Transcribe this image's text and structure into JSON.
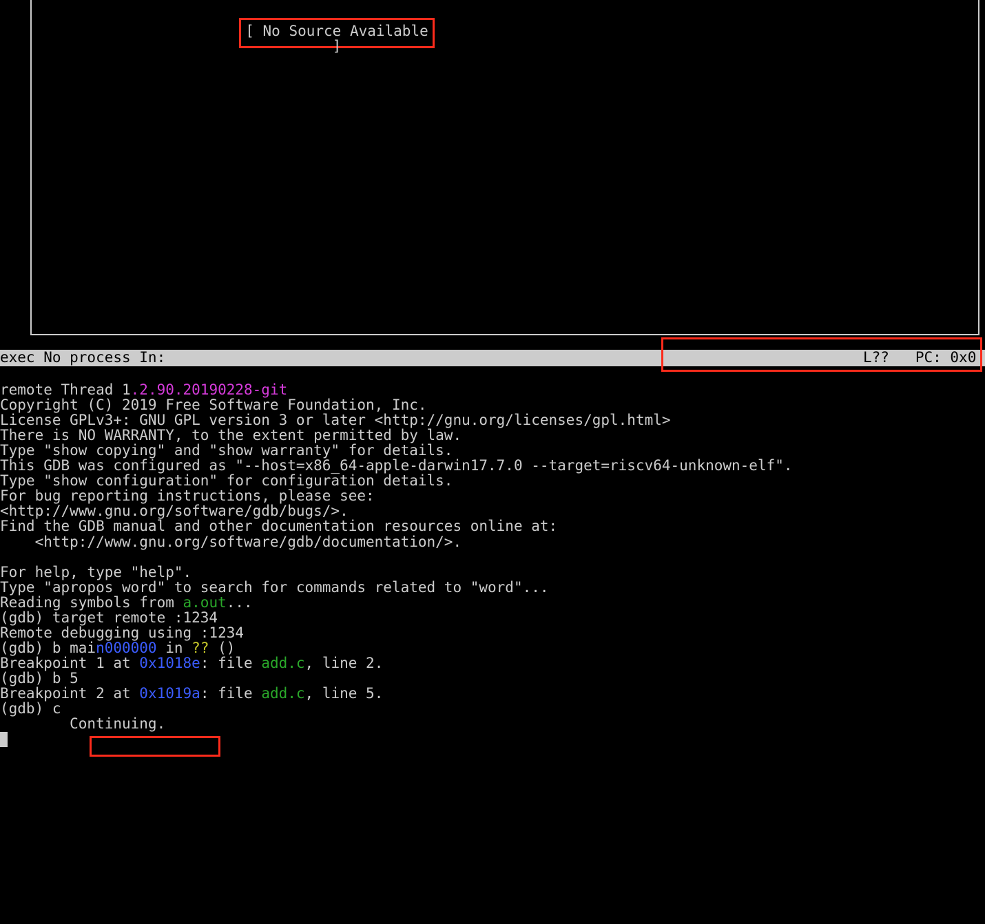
{
  "source_panel": {
    "no_source": "[ No Source Available ]"
  },
  "status_bar": {
    "left": "exec No process In:",
    "right": "L??   PC: 0x0 "
  },
  "thread_line": {
    "prefix": "remote Thread 1",
    "version": ".2.90.20190228-git"
  },
  "body_lines": [
    "Copyright (C) 2019 Free Software Foundation, Inc.",
    "License GPLv3+: GNU GPL version 3 or later <http://gnu.org/licenses/gpl.html>",
    "There is NO WARRANTY, to the extent permitted by law.",
    "Type \"show copying\" and \"show warranty\" for details.",
    "This GDB was configured as \"--host=x86_64-apple-darwin17.7.0 --target=riscv64-unknown-elf\".",
    "Type \"show configuration\" for configuration details.",
    "For bug reporting instructions, please see:",
    "<http://www.gnu.org/software/gdb/bugs/>.",
    "Find the GDB manual and other documentation resources online at:",
    "    <http://www.gnu.org/software/gdb/documentation/>.",
    "",
    "For help, type \"help\".",
    "Type \"apropos word\" to search for commands related to \"word\"..."
  ],
  "reading_symbols": {
    "prefix": "Reading symbols from ",
    "file": "a.out",
    "suffix": "..."
  },
  "gdb_cmd1": {
    "prompt": "(gdb) ",
    "cmd": "target remote :1234"
  },
  "remote_debug": "Remote debugging using :1234",
  "gdb_cmd2": {
    "prompt": "(gdb) ",
    "cmd": "b mai",
    "addr_frag": "n000000",
    "mid": " in ",
    "qq": "??",
    "tail": " ()"
  },
  "bp1": {
    "pre": "Breakpoint 1 at ",
    "addr": "0x1018e",
    "mid": ": file ",
    "file": "add.c",
    "tail": ", line 2."
  },
  "gdb_cmd3": {
    "prompt": "(gdb) ",
    "cmd": "b 5"
  },
  "bp2": {
    "pre": "Breakpoint 2 at ",
    "addr": "0x1019a",
    "mid": ": file ",
    "file": "add.c",
    "tail": ", line 5."
  },
  "gdb_cmd4": {
    "prompt": "(gdb) ",
    "cmd": "c"
  },
  "continuing": "        Continuing."
}
